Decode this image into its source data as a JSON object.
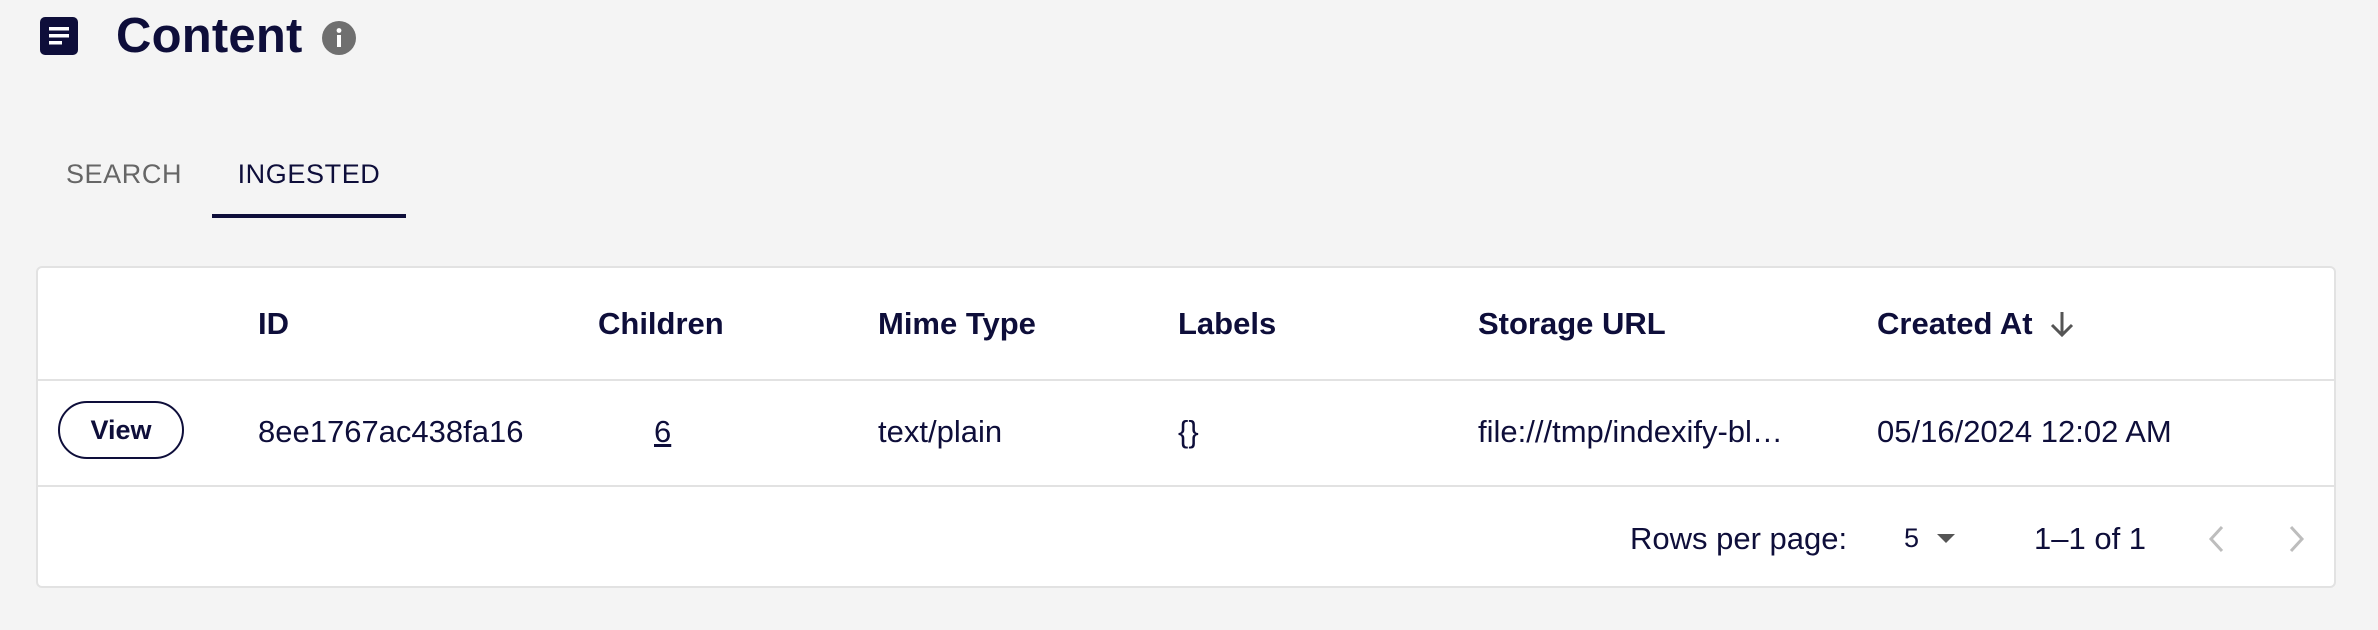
{
  "header": {
    "title": "Content",
    "icons": {
      "page": "document-list-icon",
      "info": "info-icon"
    }
  },
  "tabs": [
    {
      "label": "SEARCH",
      "active": false
    },
    {
      "label": "INGESTED",
      "active": true
    }
  ],
  "table": {
    "columns": [
      "ID",
      "Children",
      "Mime Type",
      "Labels",
      "Storage URL",
      "Created At"
    ],
    "sort": {
      "column": "Created At",
      "direction": "desc",
      "icon": "arrow-down-icon"
    },
    "rows": [
      {
        "action_label": "View",
        "id": "8ee1767ac438fa16",
        "children": "6",
        "mime_type": "text/plain",
        "labels": "{}",
        "storage_url": "file:///tmp/indexify-bl…",
        "created_at": "05/16/2024 12:02 AM"
      }
    ]
  },
  "pagination": {
    "rows_per_page_label": "Rows per page:",
    "rows_per_page_value": "5",
    "range_text": "1–1 of 1"
  },
  "colors": {
    "primary": "#0e0e3a",
    "background": "#f4f4f4",
    "muted_text": "#666666",
    "border": "#e2e2e2"
  }
}
